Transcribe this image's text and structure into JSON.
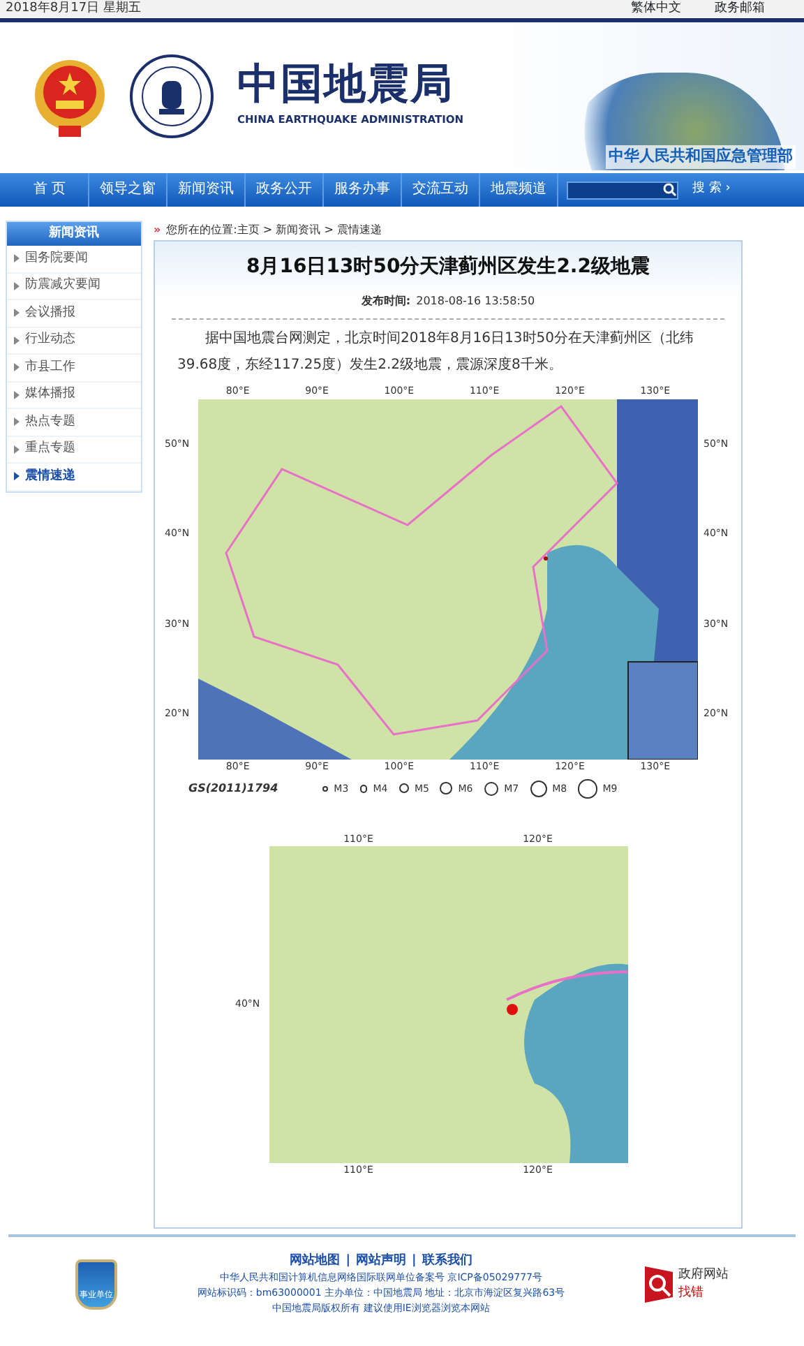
{
  "top_bar": {
    "date": "2018年8月17日 星期五",
    "links": [
      "繁体中文",
      "政务邮箱"
    ]
  },
  "header": {
    "title": "中国地震局",
    "subtitle": "CHINA EARTHQUAKE ADMINISTRATION",
    "ministry": "中华人民共和国应急管理部"
  },
  "nav": {
    "items": [
      {
        "label": "首 页",
        "selected": false
      },
      {
        "label": "领导之窗",
        "selected": false
      },
      {
        "label": "新闻资讯",
        "selected": false
      },
      {
        "label": "政务公开",
        "selected": false
      },
      {
        "label": "服务办事",
        "selected": false
      },
      {
        "label": "交流互动",
        "selected": false
      },
      {
        "label": "地震频道",
        "selected": false
      }
    ],
    "search_button": "搜 索 ›"
  },
  "sidebar": {
    "title": "新闻资讯",
    "items": [
      {
        "label": "国务院要闻",
        "selected": false
      },
      {
        "label": "防震减灾要闻",
        "selected": false
      },
      {
        "label": "会议播报",
        "selected": false
      },
      {
        "label": "行业动态",
        "selected": false
      },
      {
        "label": "市县工作",
        "selected": false
      },
      {
        "label": "媒体播报",
        "selected": false
      },
      {
        "label": "热点专题",
        "selected": false
      },
      {
        "label": "重点专题",
        "selected": false
      },
      {
        "label": "震情速递",
        "selected": true
      }
    ]
  },
  "breadcrumb_marker": "»",
  "breadcrumb": "您所在的位置:主页 > 新闻资讯 > 震情速递",
  "article": {
    "title": "8月16日13时50分天津蓟州区发生2.2级地震",
    "published_label": "发布时间:",
    "published": "2018-08-16 13:58:50",
    "body": "据中国地震台网测定，北京时间2018年8月16日13时50分在天津蓟州区（北纬39.68度，东经117.25度）发生2.2级地震，震源深度8千米。",
    "map_overview": {
      "x_labels_top": [
        "80°E",
        "90°E",
        "100°E",
        "110°E",
        "120°E",
        "130°E"
      ],
      "x_labels_bottom": [
        "80°E",
        "90°E",
        "100°E",
        "110°E",
        "120°E",
        "130°E"
      ],
      "y_labels_left": [
        "50°N",
        "40°N",
        "30°N",
        "20°N"
      ],
      "y_labels_right": [
        "50°N",
        "40°N",
        "30°N",
        "20°N"
      ]
    },
    "map_code": "GS(2011)1794",
    "legend": [
      "M3",
      "M4",
      "M5",
      "M6",
      "M7",
      "M8",
      "M9"
    ],
    "map_detail": {
      "x_labels_top": [
        "110°E",
        "120°E"
      ],
      "x_labels_bottom": [
        "110°E",
        "120°E"
      ],
      "y_labels_left": [
        "40°N"
      ]
    }
  },
  "footer": {
    "links": [
      "网站地图",
      "网站声明",
      "联系我们"
    ],
    "separators": [
      "|",
      "|"
    ],
    "lines": [
      "中华人民共和国计算机信息网络国际联网单位备案号 京ICP备05029777号",
      "网站标识码：bm63000001  主办单位：中国地震局  地址：北京市海淀区复兴路63号",
      "中国地震局版权所有 建议使用IE浏览器浏览本网站"
    ],
    "badge": "事业单位",
    "gov_label": "政府网站",
    "gov_action": "找错"
  }
}
